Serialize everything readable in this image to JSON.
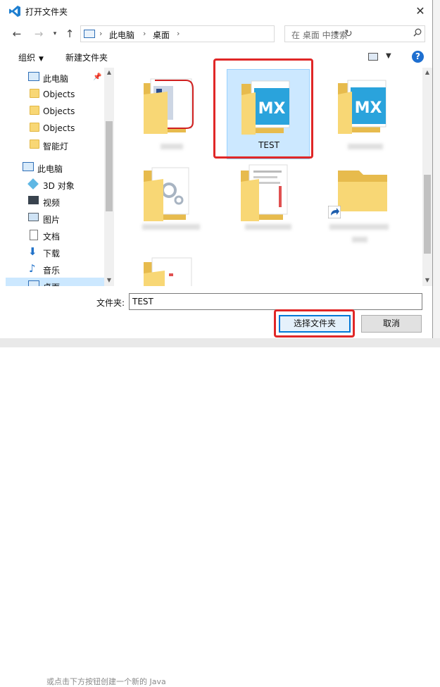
{
  "window": {
    "title": "打开文件夹"
  },
  "address": {
    "crumbs": [
      "此电脑",
      "桌面"
    ],
    "search_placeholder": "在 桌面 中搜索"
  },
  "toolbar": {
    "organize": "组织",
    "new_folder": "新建文件夹"
  },
  "sidebar": {
    "items": [
      {
        "label": "此电脑",
        "icon": "monitor-icon",
        "pinned": true
      },
      {
        "label": "Objects",
        "icon": "folder-icon"
      },
      {
        "label": "Objects",
        "icon": "folder-icon"
      },
      {
        "label": "Objects",
        "icon": "folder-icon"
      },
      {
        "label": "智能灯",
        "icon": "folder-icon"
      },
      {
        "label": "此电脑",
        "icon": "monitor-icon"
      },
      {
        "label": "3D 对象",
        "icon": "cube-icon"
      },
      {
        "label": "视频",
        "icon": "film-icon"
      },
      {
        "label": "图片",
        "icon": "picture-icon"
      },
      {
        "label": "文档",
        "icon": "document-icon"
      },
      {
        "label": "下载",
        "icon": "download-icon"
      },
      {
        "label": "音乐",
        "icon": "music-icon"
      },
      {
        "label": "桌面",
        "icon": "desktop-icon",
        "selected": true
      }
    ]
  },
  "files": [
    {
      "name": "",
      "type": "folder-doc"
    },
    {
      "name": "TEST",
      "type": "folder-mx",
      "selected": true
    },
    {
      "name": "",
      "type": "folder-mx"
    },
    {
      "name": "",
      "type": "folder-gear"
    },
    {
      "name": "",
      "type": "folder-doc"
    },
    {
      "name": "",
      "type": "folder-shortcut"
    },
    {
      "name": "",
      "type": "folder-doc"
    }
  ],
  "footer": {
    "folder_label": "文件夹:",
    "folder_value": "TEST",
    "select_button": "选择文件夹",
    "cancel_button": "取消"
  },
  "background": {
    "hint_text": "或点击下方按钮创建一个新的 Java"
  },
  "colors": {
    "accent": "#0078d7",
    "highlight": "#e02727",
    "selection": "#cce8ff",
    "folder": "#f8d775",
    "mx_blue": "#2aa3dc"
  }
}
